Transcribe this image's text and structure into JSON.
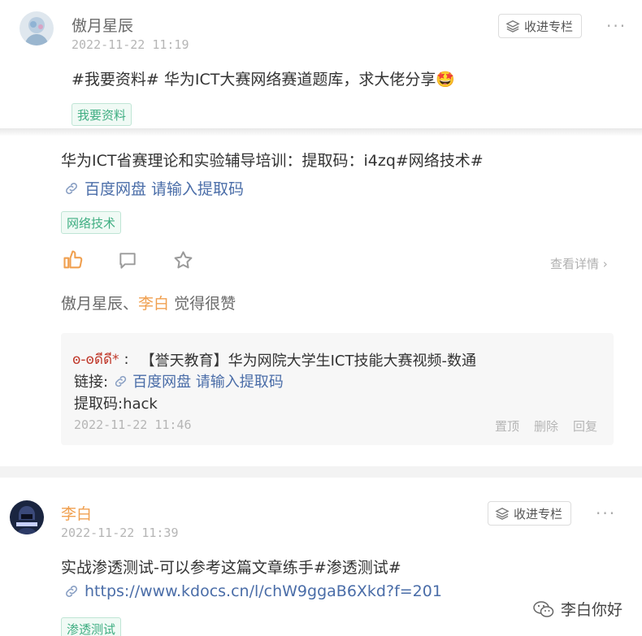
{
  "post1": {
    "author": "傲月星辰",
    "time": "2022-11-22 11:19",
    "collect_label": "收进专栏",
    "more": "···",
    "text": "#我要资料# 华为ICT大赛网络赛道题库，求大佬分享🤩",
    "tag": "我要资料"
  },
  "post2": {
    "text": "华为ICT省赛理论和实验辅导培训：提取码：i4zq#网络技术#",
    "link_text": "百度网盘 请输入提取码",
    "tag": "网络技术",
    "detail_label": "查看详情",
    "likers_1": "傲月星辰、",
    "likers_2": "李白",
    "likers_3": " 觉得很赞",
    "comment": {
      "commenter": "ꙩ-ꙩดีดี*",
      "colon": ":",
      "line1": "【誉天教育】华为网院大学生ICT技能大赛视频-数通",
      "line2_prefix": "链接:",
      "line2_link": "百度网盘 请输入提取码",
      "line3": "提取码:hack",
      "time": "2022-11-22 11:46",
      "pin": "置顶",
      "delete": "删除",
      "reply": "回复"
    }
  },
  "post3": {
    "author": "李白",
    "time": "2022-11-22 11:39",
    "collect_label": "收进专栏",
    "more": "···",
    "text": "实战渗透测试-可以参考这篇文章练手#渗透测试#",
    "link_text": "https://www.kdocs.cn/l/chW9ggaB6Xkd?f=201",
    "tag": "渗透测试"
  },
  "watermark": {
    "label": "李白你好"
  },
  "colors": {
    "accent_orange": "#f0a050",
    "link_blue": "#4a6da8",
    "tag_green": "#3fae82"
  }
}
